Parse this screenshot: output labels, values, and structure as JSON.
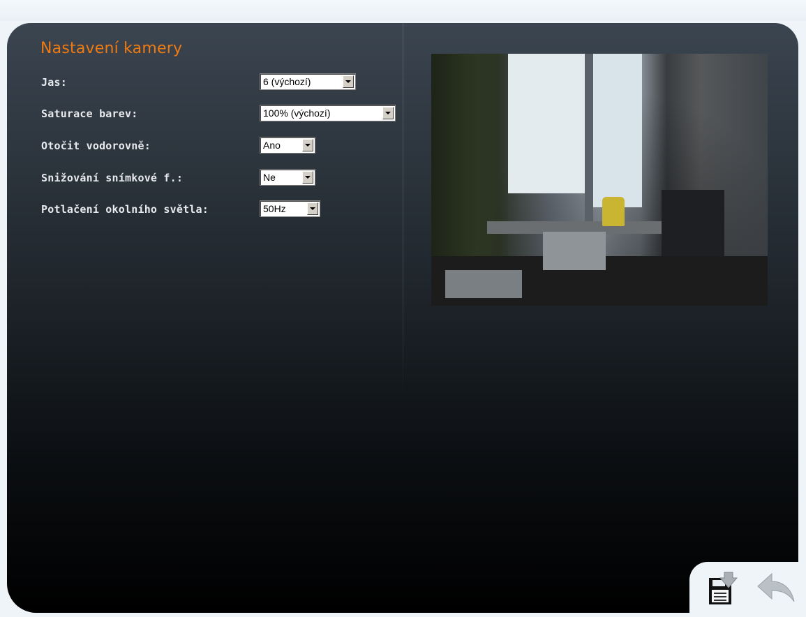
{
  "title": "Nastavení kamery",
  "settings": [
    {
      "label": "Jas:",
      "value": "6 (výchozí)"
    },
    {
      "label": "Saturace barev:",
      "value": "100% (výchozí)"
    },
    {
      "label": "Otočit vodorovně:",
      "value": "Ano"
    },
    {
      "label": "Snižování snímkové f.:",
      "value": "Ne"
    },
    {
      "label": "Potlačení okolního světla:",
      "value": "50Hz"
    }
  ],
  "icons": {
    "save": "save-icon",
    "back": "back-arrow-icon"
  },
  "colors": {
    "title": "#f07a12",
    "label": "#e7eaee",
    "panel_top": "#3b4550",
    "panel_bottom": "#000000"
  }
}
